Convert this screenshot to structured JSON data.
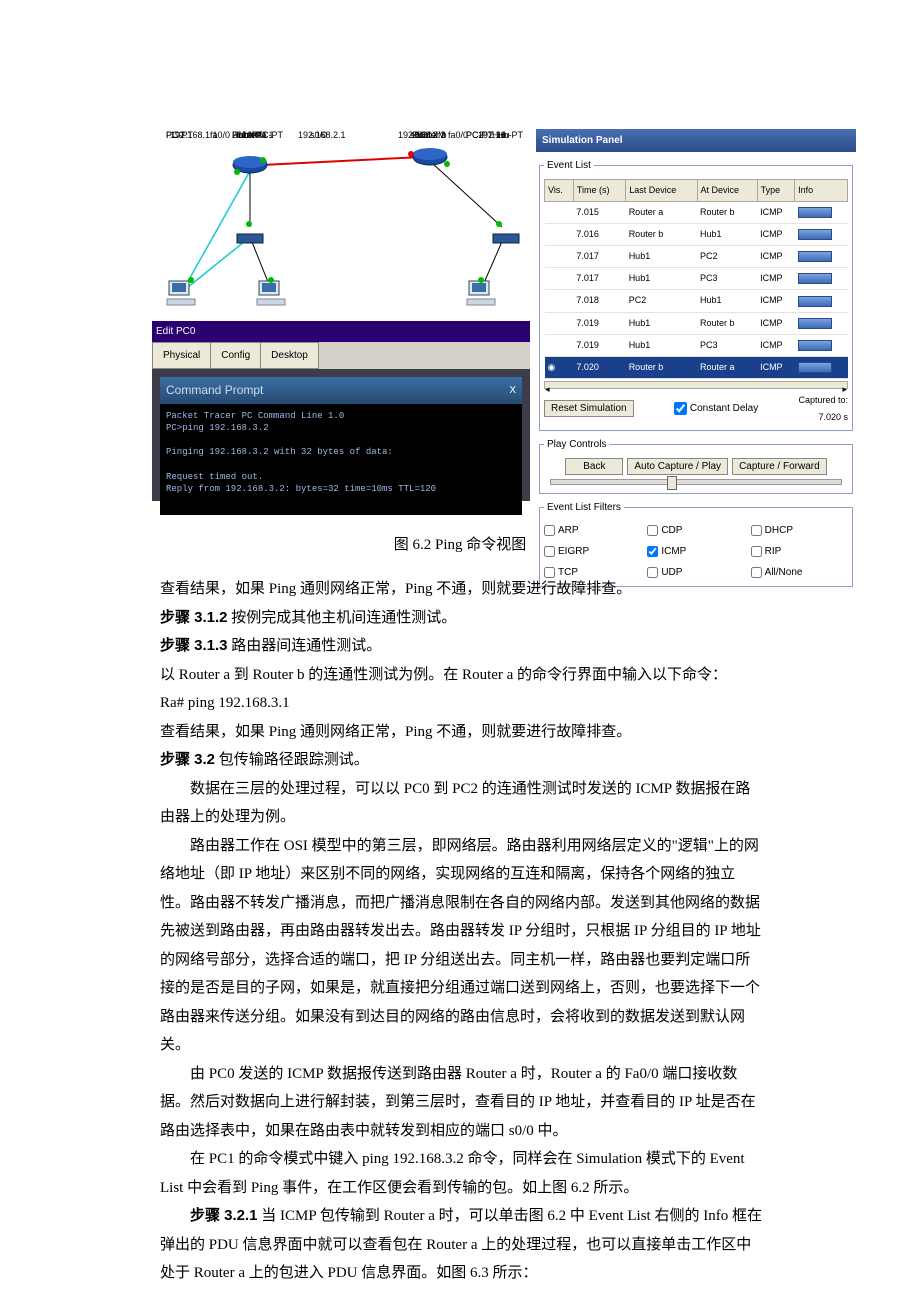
{
  "topology": {
    "labels": {
      "ip_ra_s00": "192.168.2.1",
      "ip_rb_s00": "192.168.2.2",
      "ra_s00": "s0/0",
      "rb_s00": "s0/0",
      "ra_fa00": "fa0/0",
      "rb_fa00": "fa0/0",
      "ip_ra_fa": "192.168.1.1",
      "ip_rb_fa": "192.16",
      "router_a_model": "2620XM",
      "router_b_model": "2620XM",
      "router_a": "Router a",
      "router_b": "Router b",
      "hub0_type": "Hub-PT",
      "hub0_name": "Hub0",
      "hub1_type": "Hub-PT",
      "hub1_name": "Hu",
      "pc0_type": "PC-PT",
      "pc0_name": "PC0",
      "pc1_type": "PC-PT",
      "pc1_name": "PC1",
      "pc2_type": "PC-PT",
      "pc2_name": "PC2"
    }
  },
  "editWindow": {
    "title": "Edit PC0",
    "tabs": {
      "physical": "Physical",
      "config": "Config",
      "desktop": "Desktop"
    },
    "console": {
      "title": "Command Prompt",
      "close": "X",
      "line1": "Packet Tracer PC Command Line 1.0",
      "line2": "PC>ping 192.168.3.2",
      "line3": "Pinging 192.168.3.2 with 32 bytes of data:",
      "line4": "Request timed out.",
      "line5": "Reply from 192.168.3.2: bytes=32 time=10ms TTL=120"
    }
  },
  "simPanel": {
    "title": "Simulation Panel",
    "eventList": {
      "legend": "Event List",
      "headers": {
        "vis": "Vis.",
        "time": "Time (s)",
        "last": "Last Device",
        "at": "At Device",
        "type": "Type",
        "info": "Info"
      },
      "rows": [
        {
          "time": "7.015",
          "last": "Router a",
          "at": "Router b",
          "type": "ICMP"
        },
        {
          "time": "7.016",
          "last": "Router b",
          "at": "Hub1",
          "type": "ICMP"
        },
        {
          "time": "7.017",
          "last": "Hub1",
          "at": "PC2",
          "type": "ICMP"
        },
        {
          "time": "7.017",
          "last": "Hub1",
          "at": "PC3",
          "type": "ICMP"
        },
        {
          "time": "7.018",
          "last": "PC2",
          "at": "Hub1",
          "type": "ICMP"
        },
        {
          "time": "7.019",
          "last": "Hub1",
          "at": "Router b",
          "type": "ICMP"
        },
        {
          "time": "7.019",
          "last": "Hub1",
          "at": "PC3",
          "type": "ICMP"
        },
        {
          "time": "7.020",
          "last": "Router b",
          "at": "Router a",
          "type": "ICMP",
          "selected": true,
          "vis": "◉"
        }
      ],
      "reset": "Reset Simulation",
      "constDelay": "Constant Delay",
      "captured": "Captured to:",
      "capturedVal": "7.020 s"
    },
    "play": {
      "legend": "Play Controls",
      "back": "Back",
      "auto": "Auto Capture / Play",
      "fwd": "Capture / Forward"
    },
    "filters": {
      "legend": "Event List Filters",
      "arp": "ARP",
      "cdp": "CDP",
      "dhcp": "DHCP",
      "eigrp": "EIGRP",
      "icmp": "ICMP",
      "rip": "RIP",
      "tcp": "TCP",
      "udp": "UDP",
      "all": "All/None"
    }
  },
  "caption": "图 6.2    Ping 命令视图",
  "text": {
    "p1": "查看结果，如果 Ping 通则网络正常，Ping  不通，则就要进行故障排查。",
    "p2b": "步骤 3.1.2",
    "p2": "    按例完成其他主机间连通性测试。",
    "p3b": "步骤 3.1.3",
    "p3": "    路由器间连通性测试。",
    "p4": "以 Router a 到 Router b  的连通性测试为例。在 Router a  的命令行界面中输入以下命令：",
    "p5": "Ra# ping 192.168.3.1",
    "p6": "查看结果，如果 Ping 通则网络正常，Ping  不通，则就要进行故障排查。",
    "p7b": "步骤 3.2",
    "p7": "    包传输路径跟踪测试。",
    "p8": "数据在三层的处理过程，可以以 PC0 到 PC2 的连通性测试时发送的 ICMP 数据报在路由器上的处理为例。",
    "p9": "路由器工作在 OSI 模型中的第三层，即网络层。路由器利用网络层定义的\"逻辑\"上的网络地址（即 IP 地址）来区别不同的网络，实现网络的互连和隔离，保持各个网络的独立性。路由器不转发广播消息，而把广播消息限制在各自的网络内部。发送到其他网络的数据先被送到路由器，再由路由器转发出去。路由器转发 IP 分组时，只根据 IP 分组目的 IP 地址的网络号部分，选择合适的端口，把 IP 分组送出去。同主机一样，路由器也要判定端口所接的是否是目的子网，如果是，就直接把分组通过端口送到网络上，否则，也要选择下一个路由器来传送分组。如果没有到达目的网络的路由信息时，会将收到的数据发送到默认网关。",
    "p10": "由 PC0  发送的 ICMP 数据报传送到路由器 Router a  时，Router a 的 Fa0/0 端口接收数据。然后对数据向上进行解封装，到第三层时，查看目的 IP 地址，并查看目的 IP 址是否在路由选择表中，如果在路由表中就转发到相应的端口 s0/0 中。",
    "p11": "在 PC1 的命令模式中键入 ping 192.168.3.2 命令，同样会在 Simulation 模式下的 Event List 中会看到 Ping 事件，在工作区便会看到传输的包。如上图 6.2 所示。",
    "p12b": "步骤 3.2.1",
    "p12a": "  当 ICMP 包传输到 Router a  时，可以单击图 6.2 中  Event List 右侧的 Info 框在弹出的 PDU  信息界面中就可以查看包在 Router a 上的处理过程，也可以直接单击工作区中处于 Router a 上的包进入 PDU  信息界面。如图 6.3 所示："
  }
}
